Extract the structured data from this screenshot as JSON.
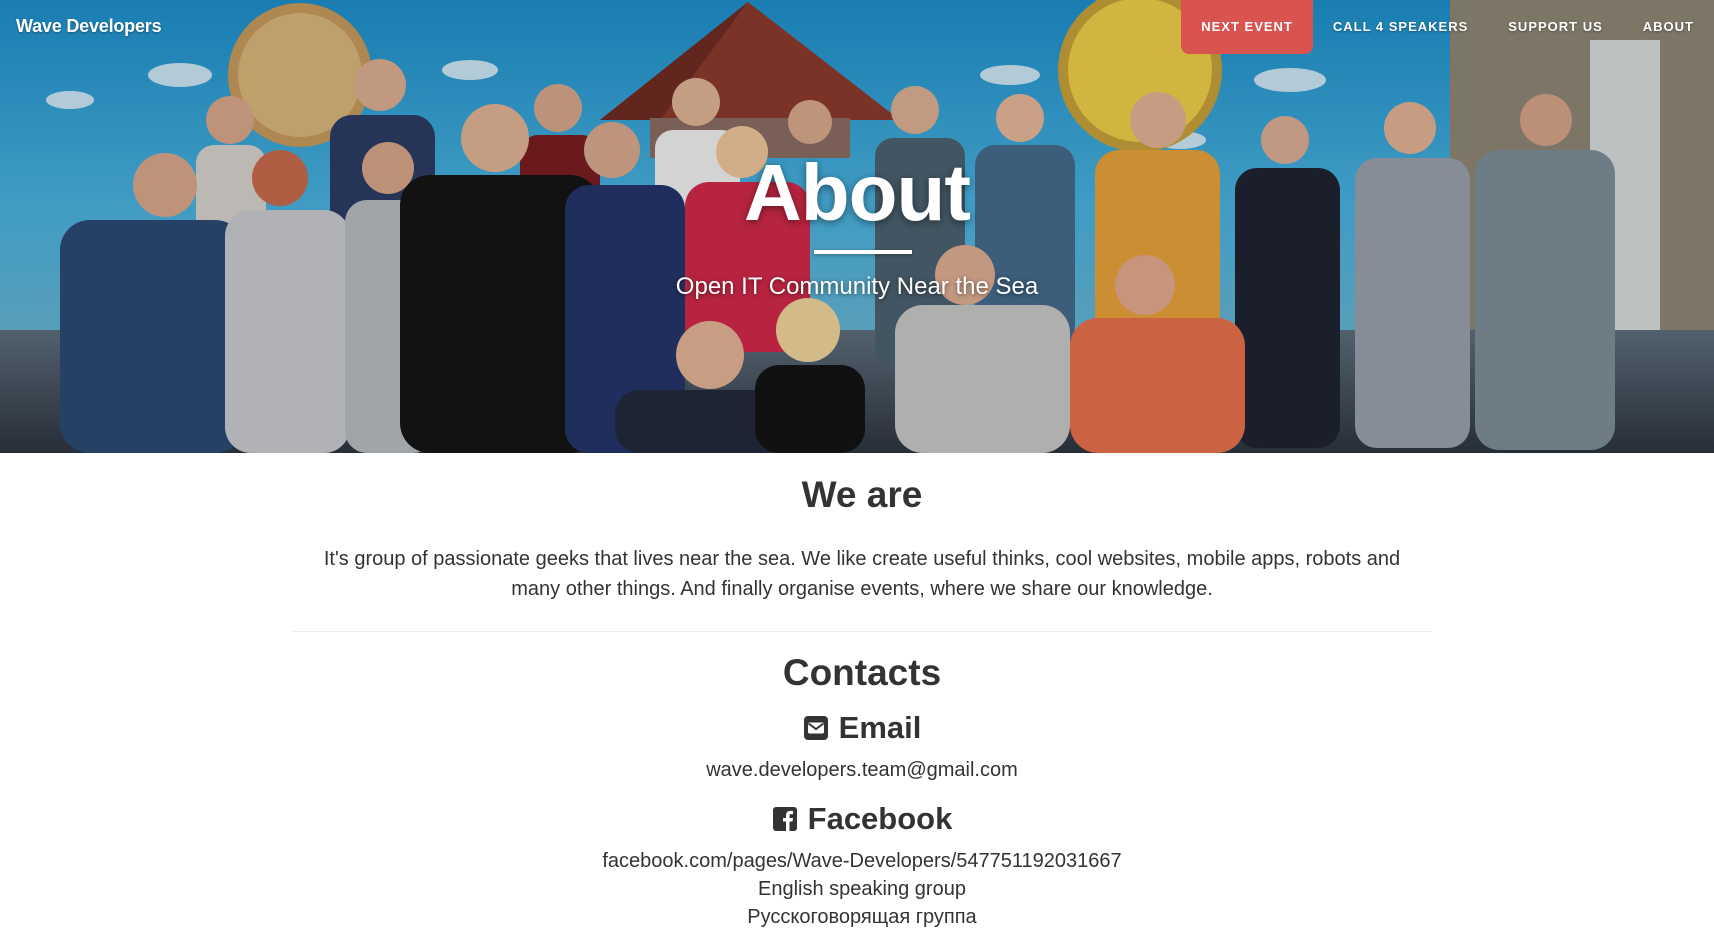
{
  "brand": {
    "name": "Wave Developers"
  },
  "nav": {
    "items": [
      {
        "label": "NEXT EVENT",
        "active": true
      },
      {
        "label": "CALL 4 SPEAKERS",
        "active": false
      },
      {
        "label": "SUPPORT US",
        "active": false
      },
      {
        "label": "ABOUT",
        "active": false
      }
    ],
    "active_color": "#d9534f"
  },
  "hero": {
    "title": "About",
    "subtitle": "Open IT Community Near the Sea"
  },
  "about": {
    "heading": "We are",
    "text": "It's group of passionate geeks that lives near the sea. We like create useful thinks, cool websites, mobile apps, robots and many other things. And finally organise events, where we share our knowledge."
  },
  "contacts": {
    "heading": "Contacts",
    "email": {
      "heading": "Email",
      "icon": "envelope-icon",
      "value": "wave.developers.team@gmail.com"
    },
    "facebook": {
      "heading": "Facebook",
      "icon": "facebook-icon",
      "link": "facebook.com/pages/Wave-Developers/547751192031667",
      "groups": [
        "English speaking group",
        "Русскоговорящая группа"
      ]
    }
  }
}
